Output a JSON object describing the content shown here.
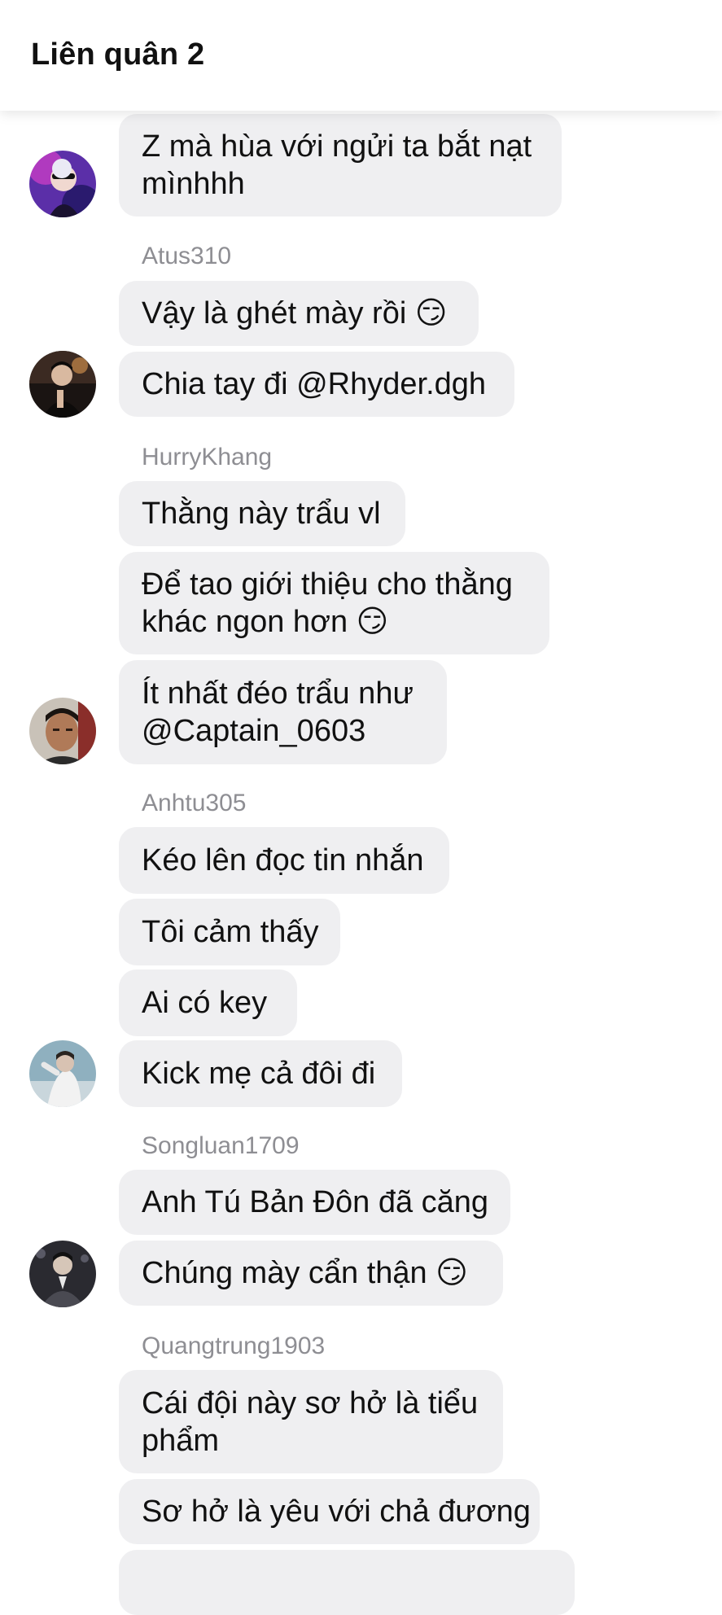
{
  "header": {
    "title": "Liên quân 2"
  },
  "emoji": {
    "smirk": "😏"
  },
  "messages": [
    {
      "text_lines": [
        "Z mà hùa với ngửi ta bắt nạt",
        "mìnhhh"
      ]
    },
    {
      "sender": "Atus310"
    },
    {
      "text": "Vậy là ghét mày rồi",
      "emoji": "smirk"
    },
    {
      "text": "Chia tay đi @Rhyder.dgh"
    },
    {
      "sender": "HurryKhang"
    },
    {
      "text": "Thằng này trẩu vl"
    },
    {
      "text_lines": [
        "Để tao giới thiệu cho thằng",
        "khác ngon hơn"
      ],
      "emoji": "smirk"
    },
    {
      "text_lines": [
        "Ít nhất đéo trẩu như",
        "@Captain_0603"
      ]
    },
    {
      "sender": "Anhtu305"
    },
    {
      "text": "Kéo lên đọc tin nhắn"
    },
    {
      "text": "Tôi cảm thấy"
    },
    {
      "text": "Ai có key"
    },
    {
      "text": "Kick mẹ cả đôi đi"
    },
    {
      "sender": "Songluan1709"
    },
    {
      "text": "Anh Tú Bản Đôn đã căng"
    },
    {
      "text": "Chúng mày cẩn thận",
      "emoji": "smirk"
    },
    {
      "sender": "Quangtrung1903"
    },
    {
      "text_lines": [
        "Cái đội này sơ hở là tiểu",
        "phẩm"
      ]
    },
    {
      "text": "Sơ hở là yêu với chả đương"
    }
  ]
}
